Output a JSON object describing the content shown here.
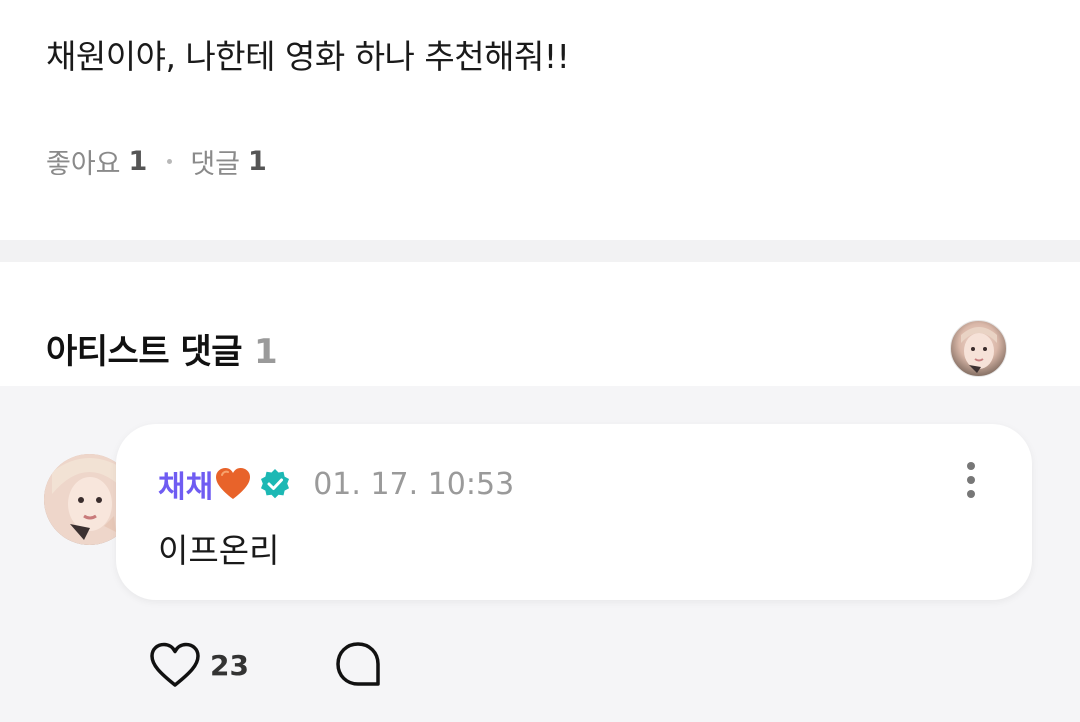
{
  "post": {
    "text": "채원이야, 나한테 영화 하나 추천해줘!!",
    "likes_label": "좋아요",
    "likes_count": "1",
    "comments_label": "댓글",
    "comments_count": "1"
  },
  "artist_comments": {
    "title": "아티스트 댓글",
    "count": "1",
    "header_avatar_icon": "artist-avatar"
  },
  "comment": {
    "author": "채채",
    "author_emoji": "orange-heart-icon",
    "verified_icon": "verified-badge-icon",
    "timestamp": "01. 17. 10:53",
    "body": "이프온리",
    "like_count": "23",
    "more_icon": "more-vertical-icon",
    "reply_icon": "reply-bubble-icon"
  },
  "colors": {
    "author_name": "#6f5cf2",
    "verified_badge": "#1cb8b4",
    "background_gray": "#f5f5f7"
  }
}
